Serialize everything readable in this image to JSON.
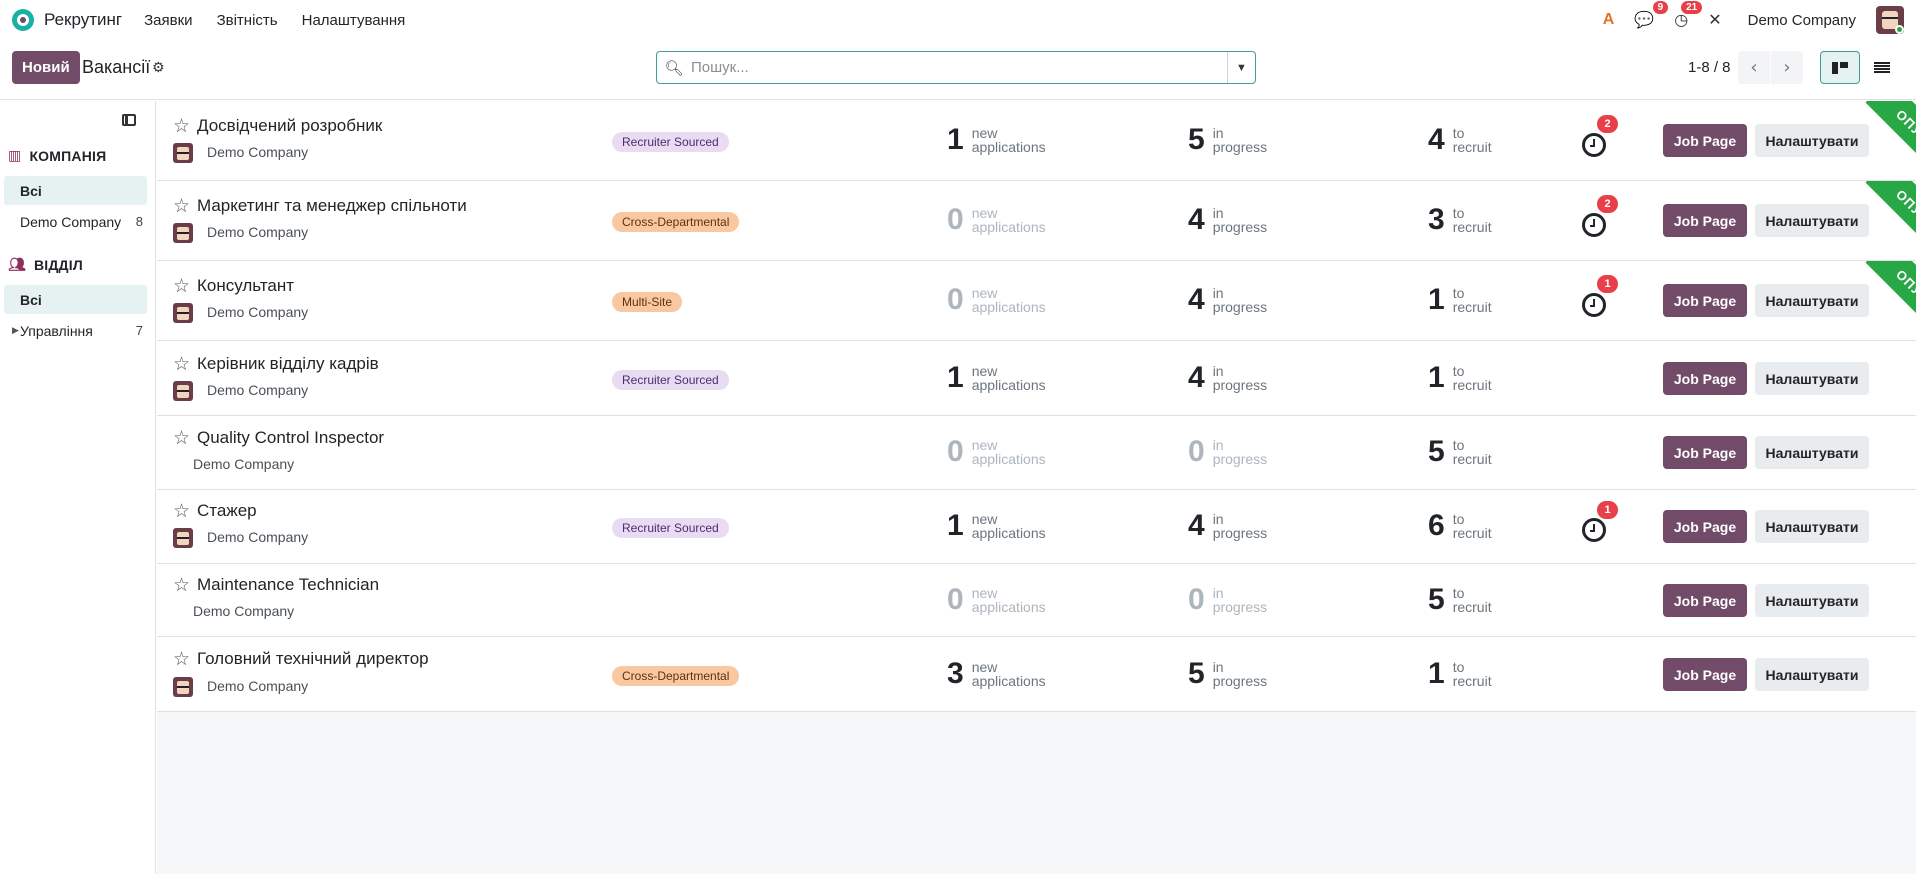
{
  "navbar": {
    "app_name": "Рекрутинг",
    "menus": [
      "Заявки",
      "Звітність",
      "Налаштування"
    ],
    "messages_count": "9",
    "activities_count": "21",
    "company": "Demo Company"
  },
  "control": {
    "new_label": "Новий",
    "title": "Вакансії",
    "search_placeholder": "Пошук...",
    "pager": "1-8 / 8"
  },
  "sidebar": {
    "company_heading": "КОМПАНІЯ",
    "company_items": [
      {
        "label": "Всі",
        "count": ""
      },
      {
        "label": "Demo Company",
        "count": "8"
      }
    ],
    "department_heading": "ВІДДІЛ",
    "department_items": [
      {
        "label": "Всі",
        "count": ""
      },
      {
        "label": "Управління",
        "count": "7"
      }
    ]
  },
  "labels": {
    "new": "new",
    "applications": "applications",
    "in": "in",
    "progress": "progress",
    "to": "to",
    "recruit": "recruit",
    "job_page": "Job Page",
    "configure": "Налаштувати",
    "ribbon": "ОПУБЛ",
    "ribbon_o": "О"
  },
  "jobs": [
    {
      "title": "Досвідчений розробник",
      "company": "Demo Company",
      "tag": "Recruiter Sourced",
      "new": "1",
      "in_progress": "5",
      "to_recruit": "4",
      "activities": "2",
      "published": true
    },
    {
      "title": "Маркетинг та менеджер спільноти",
      "company": "Demo Company",
      "tag": "Cross-Departmental",
      "new": "0",
      "in_progress": "4",
      "to_recruit": "3",
      "activities": "2",
      "published": true
    },
    {
      "title": "Консультант",
      "company": "Demo Company",
      "tag": "Multi-Site",
      "new": "0",
      "in_progress": "4",
      "to_recruit": "1",
      "activities": "1",
      "published": true
    },
    {
      "title": "Керівник відділу кадрів",
      "company": "Demo Company",
      "tag": "Recruiter Sourced",
      "new": "1",
      "in_progress": "4",
      "to_recruit": "1",
      "activities": "",
      "published": false
    },
    {
      "title": "Quality Control Inspector",
      "company": "Demo Company",
      "tag": "",
      "new": "0",
      "in_progress": "0",
      "to_recruit": "5",
      "activities": "",
      "published": false
    },
    {
      "title": "Стажер",
      "company": "Demo Company",
      "tag": "Recruiter Sourced",
      "new": "1",
      "in_progress": "4",
      "to_recruit": "6",
      "activities": "1",
      "published": false
    },
    {
      "title": "Maintenance Technician",
      "company": "Demo Company",
      "tag": "",
      "new": "0",
      "in_progress": "0",
      "to_recruit": "5",
      "activities": "",
      "published": false
    },
    {
      "title": "Головний технічний директор",
      "company": "Demo Company",
      "tag": "Cross-Departmental",
      "new": "3",
      "in_progress": "5",
      "to_recruit": "1",
      "activities": "",
      "published": false
    }
  ],
  "colors": {
    "brand": "#714b67",
    "accent": "#3e9d95",
    "badge": "#e8404a",
    "ribbon": "#28a745"
  }
}
